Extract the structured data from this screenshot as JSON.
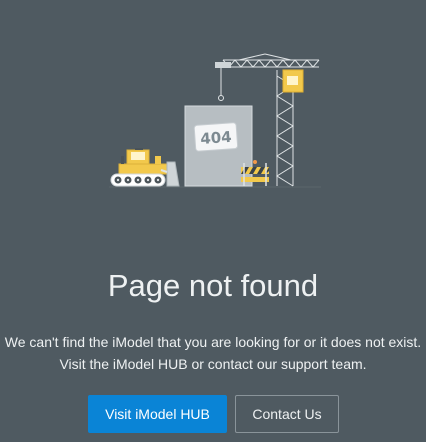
{
  "error": {
    "title": "Page not found",
    "line1": "We can't find the iModel that you are looking for or it does not exist.",
    "line2": "Visit the iModel HUB or contact our support team.",
    "sign_text": "404"
  },
  "actions": {
    "primary_label": "Visit iModel HUB",
    "secondary_label": "Contact Us"
  },
  "colors": {
    "background": "#4f5a61",
    "accent": "#0a84d6",
    "text": "#eef1f2"
  },
  "icons": {
    "illustration": "construction-404-icon"
  }
}
